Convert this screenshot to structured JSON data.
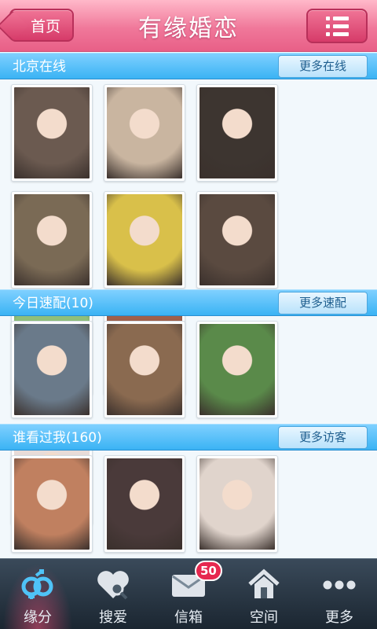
{
  "header": {
    "back_label": "首页",
    "title": "有缘婚恋"
  },
  "sections": [
    {
      "title": "北京在线",
      "more_label": "更多在线",
      "photos": [
        {
          "tone": "#6b5a50"
        },
        {
          "tone": "#c9b5a0"
        },
        {
          "tone": "#3d3530"
        },
        {
          "tone": "#7a6a55"
        },
        {
          "tone": "#d9c04a"
        },
        {
          "tone": "#5a4a40"
        },
        {
          "tone": "#8fbf7a"
        },
        {
          "tone": "#a0604a"
        }
      ]
    },
    {
      "title": "今日速配(10)",
      "more_label": "更多速配",
      "photos": [
        {
          "tone": "#6a7a8a"
        },
        {
          "tone": "#8a6a50"
        },
        {
          "tone": "#5a8a4a"
        },
        {
          "tone": "#e8dcd8"
        }
      ]
    },
    {
      "title": "谁看过我(160)",
      "more_label": "更多访客",
      "photos": [
        {
          "tone": "#c08060"
        },
        {
          "tone": "#4a3a3a"
        },
        {
          "tone": "#e0d4cc"
        },
        {
          "tone": "#3a3a40"
        }
      ]
    }
  ],
  "nav": {
    "items": [
      {
        "label": "缘分",
        "icon": "gender-pair-icon",
        "active": true
      },
      {
        "label": "搜爱",
        "icon": "heart-search-icon"
      },
      {
        "label": "信箱",
        "icon": "mail-icon",
        "badge": "50"
      },
      {
        "label": "空间",
        "icon": "house-icon"
      },
      {
        "label": "更多",
        "icon": "more-dots-icon"
      }
    ]
  },
  "colors": {
    "header_pink": "#ec6b91",
    "section_blue": "#3ab3f4",
    "nav_dark": "#1b2631",
    "badge_red": "#e6284f"
  }
}
